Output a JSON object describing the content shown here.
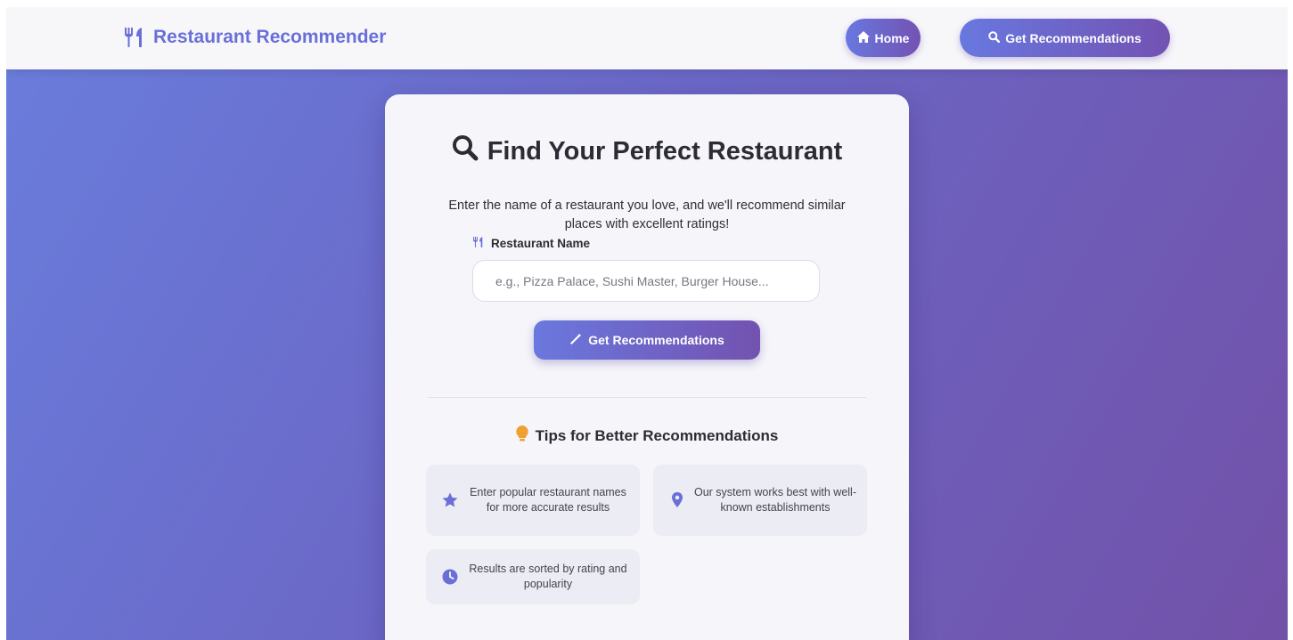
{
  "navbar": {
    "brand": "Restaurant Recommender",
    "brand_icon": "utensils-icon",
    "home_label": "Home",
    "home_icon": "home-icon",
    "rec_label": "Get Recommendations",
    "rec_icon": "search-icon"
  },
  "main": {
    "title": "Find Your Perfect Restaurant",
    "title_icon": "search-icon",
    "intro": "Enter the name of a restaurant you love, and we'll recommend similar places with excellent ratings!",
    "field_label": "Restaurant Name",
    "field_icon": "utensils-icon",
    "input_placeholder": "e.g., Pizza Palace, Sushi Master, Burger House...",
    "input_value": "",
    "submit_label": "Get Recommendations",
    "submit_icon": "magic-wand-icon"
  },
  "tips": {
    "title": "Tips for Better Recommendations",
    "title_icon": "lightbulb-icon",
    "items": [
      {
        "icon": "star-icon",
        "text": "Enter popular restaurant names for more accurate results"
      },
      {
        "icon": "map-marker-icon",
        "text": "Our system works best with well-known establishments"
      },
      {
        "icon": "clock-icon",
        "text": "Results are sorted by rating and popularity"
      }
    ]
  },
  "colors": {
    "accent": "#6a6fd8",
    "gradient_start": "#6a7ddc",
    "gradient_end": "#7251a8",
    "lightbulb": "#f0a030"
  }
}
